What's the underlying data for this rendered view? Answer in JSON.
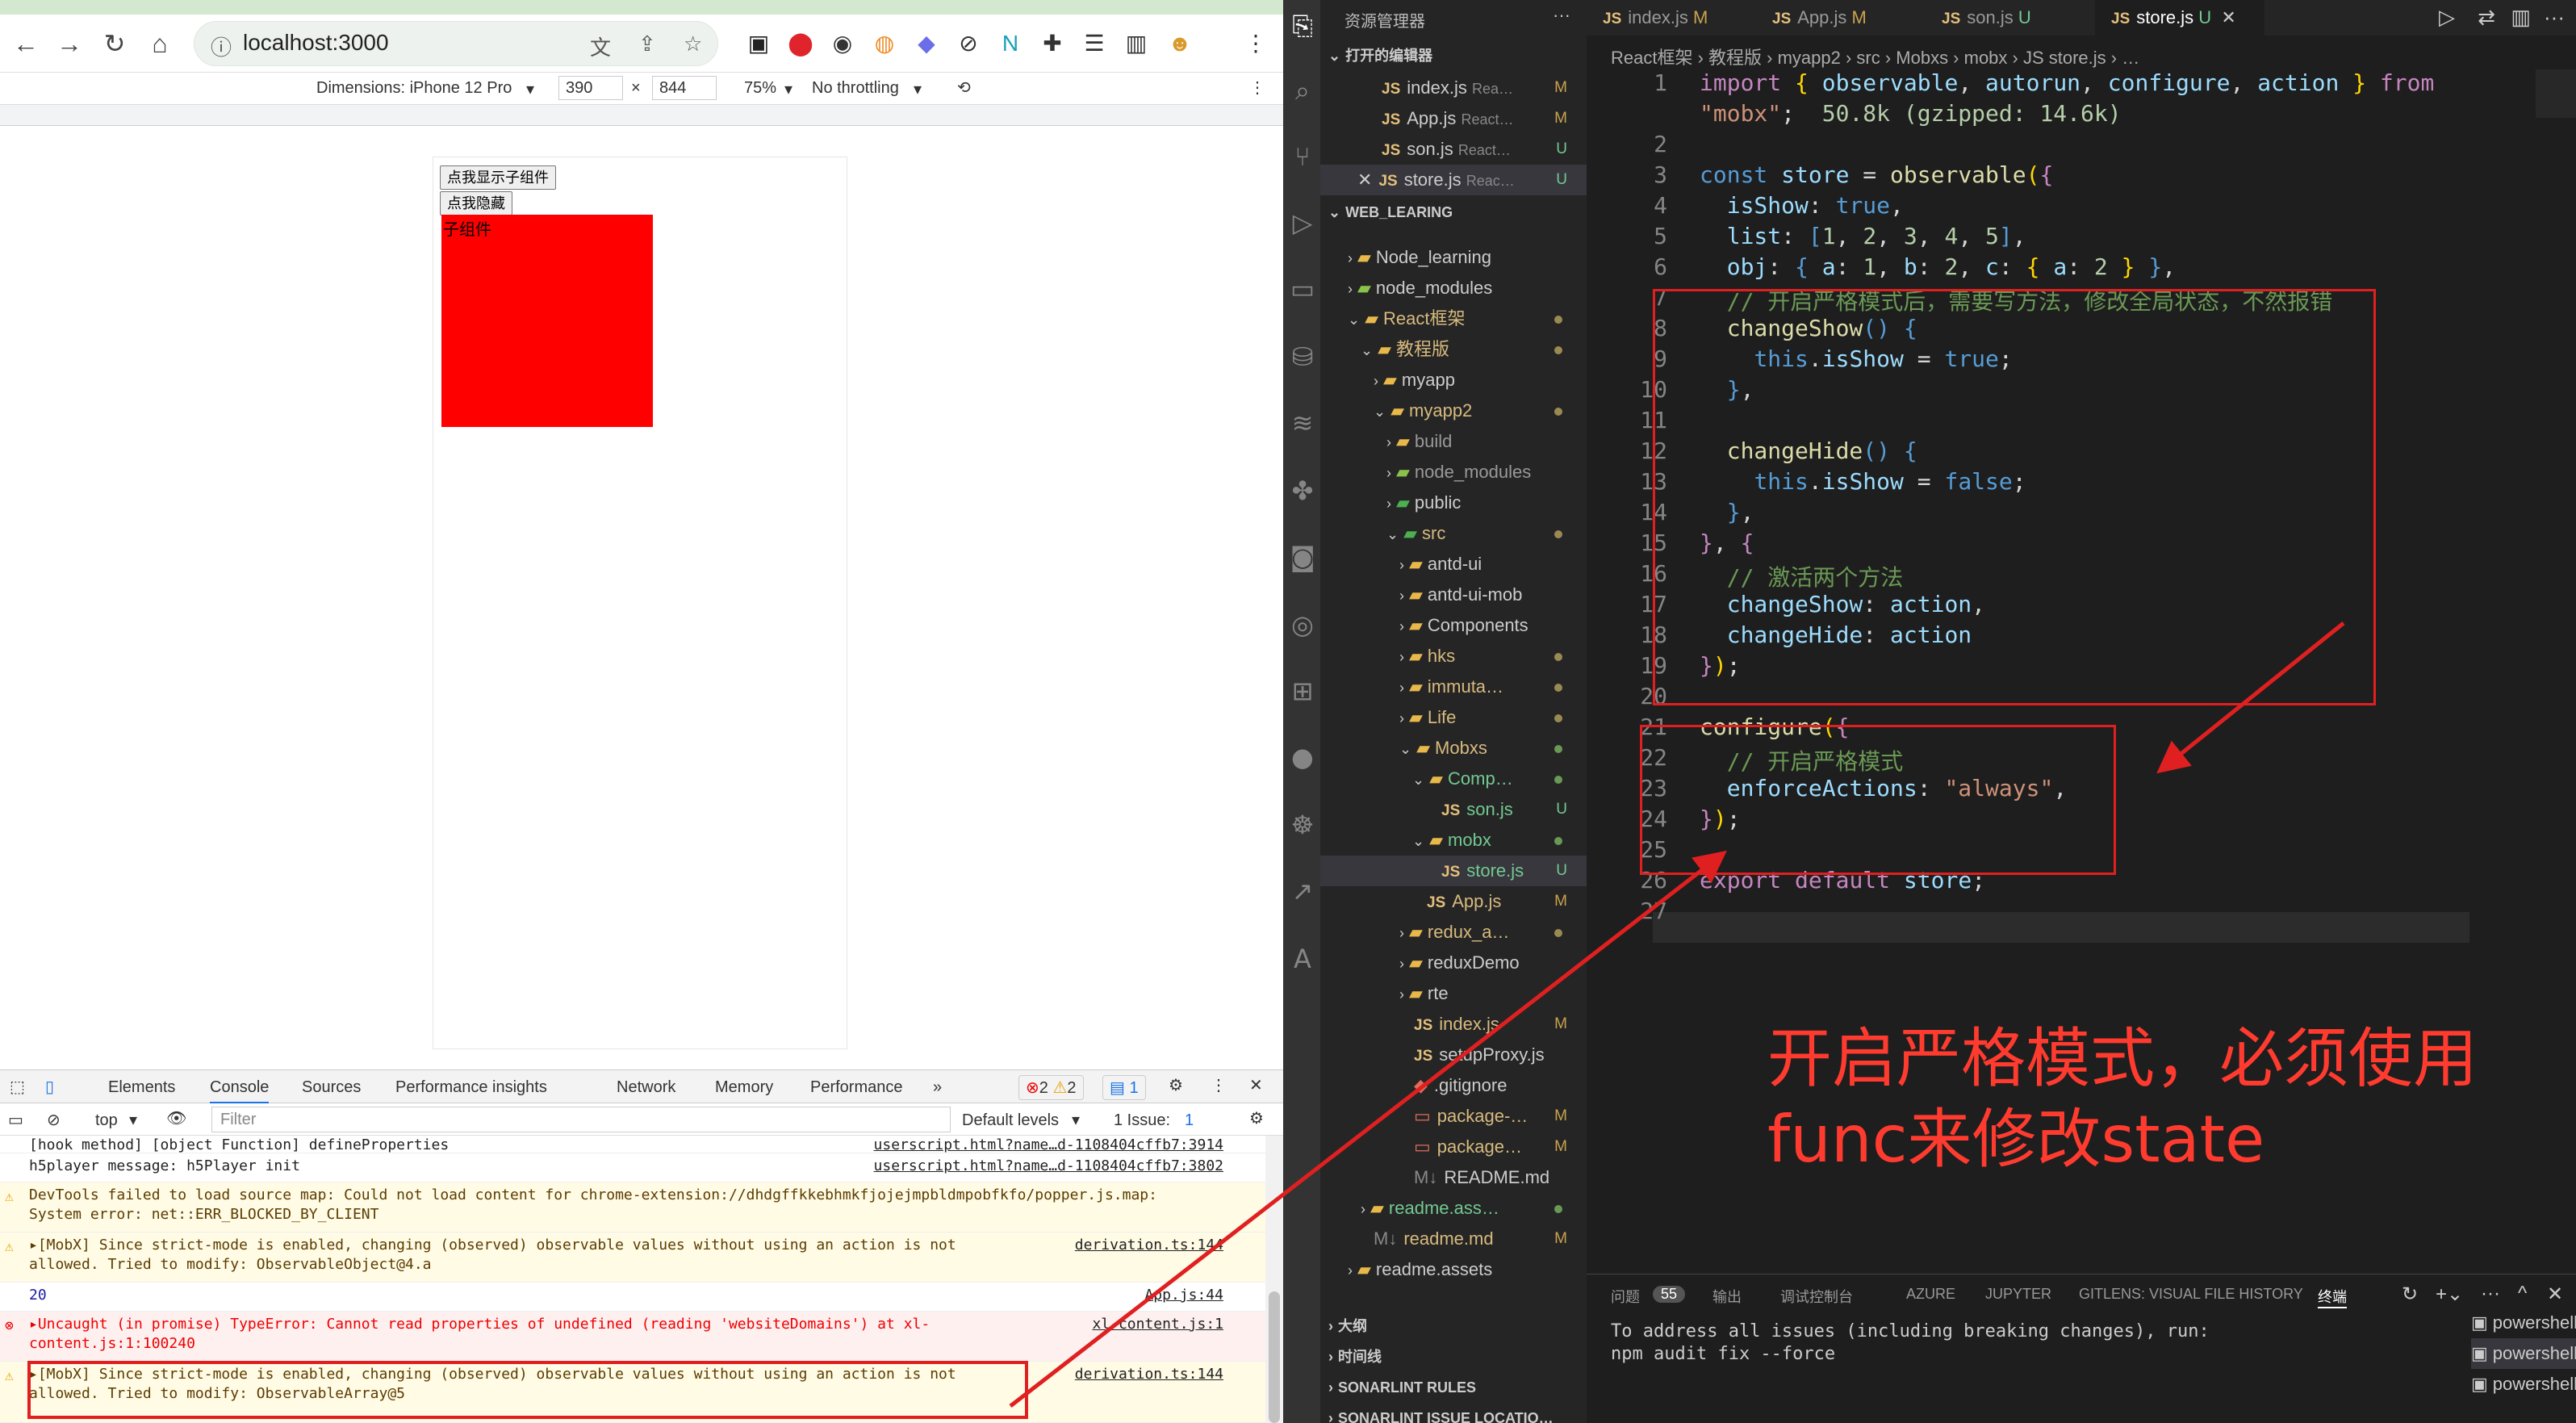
{
  "browser": {
    "url": "localhost:3000",
    "device": "Dimensions: iPhone 12 Pro",
    "width": "390",
    "height": "844",
    "zoom": "75%",
    "throttle": "No throttling"
  },
  "page": {
    "btn_show": "点我显示子组件",
    "btn_hide": "点我隐藏",
    "child_label": "子组件"
  },
  "devtools": {
    "tabs": [
      "Elements",
      "Console",
      "Sources",
      "Performance insights",
      "Network",
      "Memory",
      "Performance"
    ],
    "errors": "2",
    "warnings": "2",
    "info": "1",
    "context": "top",
    "filter_placeholder": "Filter",
    "levels": "Default levels",
    "issues": "1 Issue:",
    "issues_count": "1",
    "lines": [
      {
        "text": "[hook method] [object Function] defineProperties",
        "src": "userscript.html?name…d-1108404cffb7:3914",
        "type": "log"
      },
      {
        "text": "h5player message:  h5Player init",
        "src": "userscript.html?name…d-1108404cffb7:3802",
        "type": "log"
      },
      {
        "text": "DevTools failed to load source map: Could not load content for chrome-extension://dhdgffkkebhmkfjojejmpbldmpobfkfo/popper.js.map: System error: net::ERR_BLOCKED_BY_CLIENT",
        "src": "",
        "type": "warn"
      },
      {
        "text": "▸[MobX] Since strict-mode is enabled, changing (observed) observable values without using an action is not allowed. Tried to modify: ObservableObject@4.a",
        "src": "derivation.ts:144",
        "type": "warn"
      },
      {
        "text": "20",
        "src": "App.js:44",
        "type": "log"
      },
      {
        "text": "▸Uncaught (in promise) TypeError: Cannot read properties of undefined (reading 'websiteDomains')    at xl-content.js:1:100240",
        "src": "xl-content.js:1",
        "type": "err"
      },
      {
        "text": "▸[MobX] Since strict-mode is enabled, changing (observed) observable values without using an action is not allowed. Tried to modify: ObservableArray@5",
        "src": "derivation.ts:144",
        "type": "warn"
      }
    ]
  },
  "vscode": {
    "explorer_title": "资源管理器",
    "open_editors": "打开的编辑器",
    "workspace": "WEB_LEARING",
    "open_files": [
      {
        "name": "index.js",
        "hint": "Rea…",
        "badge": "M"
      },
      {
        "name": "App.js",
        "hint": "React…",
        "badge": "M"
      },
      {
        "name": "son.js",
        "hint": "React…",
        "badge": "U"
      },
      {
        "name": "store.js",
        "hint": "Reac…",
        "badge": "U"
      }
    ],
    "tree": [
      "Node_learning",
      "node_modules",
      "React框架",
      "教程版",
      "myapp",
      "myapp2",
      "build",
      "node_modules",
      "public",
      "src",
      "antd-ui",
      "antd-ui-mob",
      "Components",
      "hks",
      "immuta…",
      "Life",
      "Mobxs",
      "Comp…",
      "son.js",
      "mobx",
      "store.js",
      "App.js",
      "redux_a…",
      "reduxDemo",
      "rte",
      "index.js",
      "setupProxy.js",
      ".gitignore",
      "package-…",
      "package…",
      "README.md",
      "readme.ass…",
      "readme.md",
      "readme.assets"
    ],
    "outline": "大纲",
    "timeline": "时间线",
    "sonar": "SONARLINT RULES",
    "sonar2": "SONARLINT ISSUE LOCATIO…",
    "tabs": [
      {
        "name": "index.js",
        "badge": "M"
      },
      {
        "name": "App.js",
        "badge": "M"
      },
      {
        "name": "son.js",
        "badge": "U"
      },
      {
        "name": "store.js",
        "badge": "U"
      }
    ],
    "breadcrumb": "React框架 › 教程版 › myapp2 › src › Mobxs › mobx › JS store.js › …",
    "panel_tabs": [
      "问题",
      "55",
      "输出",
      "调试控制台",
      "AZURE",
      "JUPYTER",
      "GITLENS: VISUAL FILE HISTORY",
      "终端"
    ],
    "terminal": [
      "To address all issues (including breaking changes), run:",
      "  npm audit fix --force"
    ],
    "terminals": [
      "powershell",
      "powershell",
      "powershell"
    ]
  },
  "annotation": {
    "line1": "开启严格模式，必须使用",
    "line2": "func来修改state"
  }
}
